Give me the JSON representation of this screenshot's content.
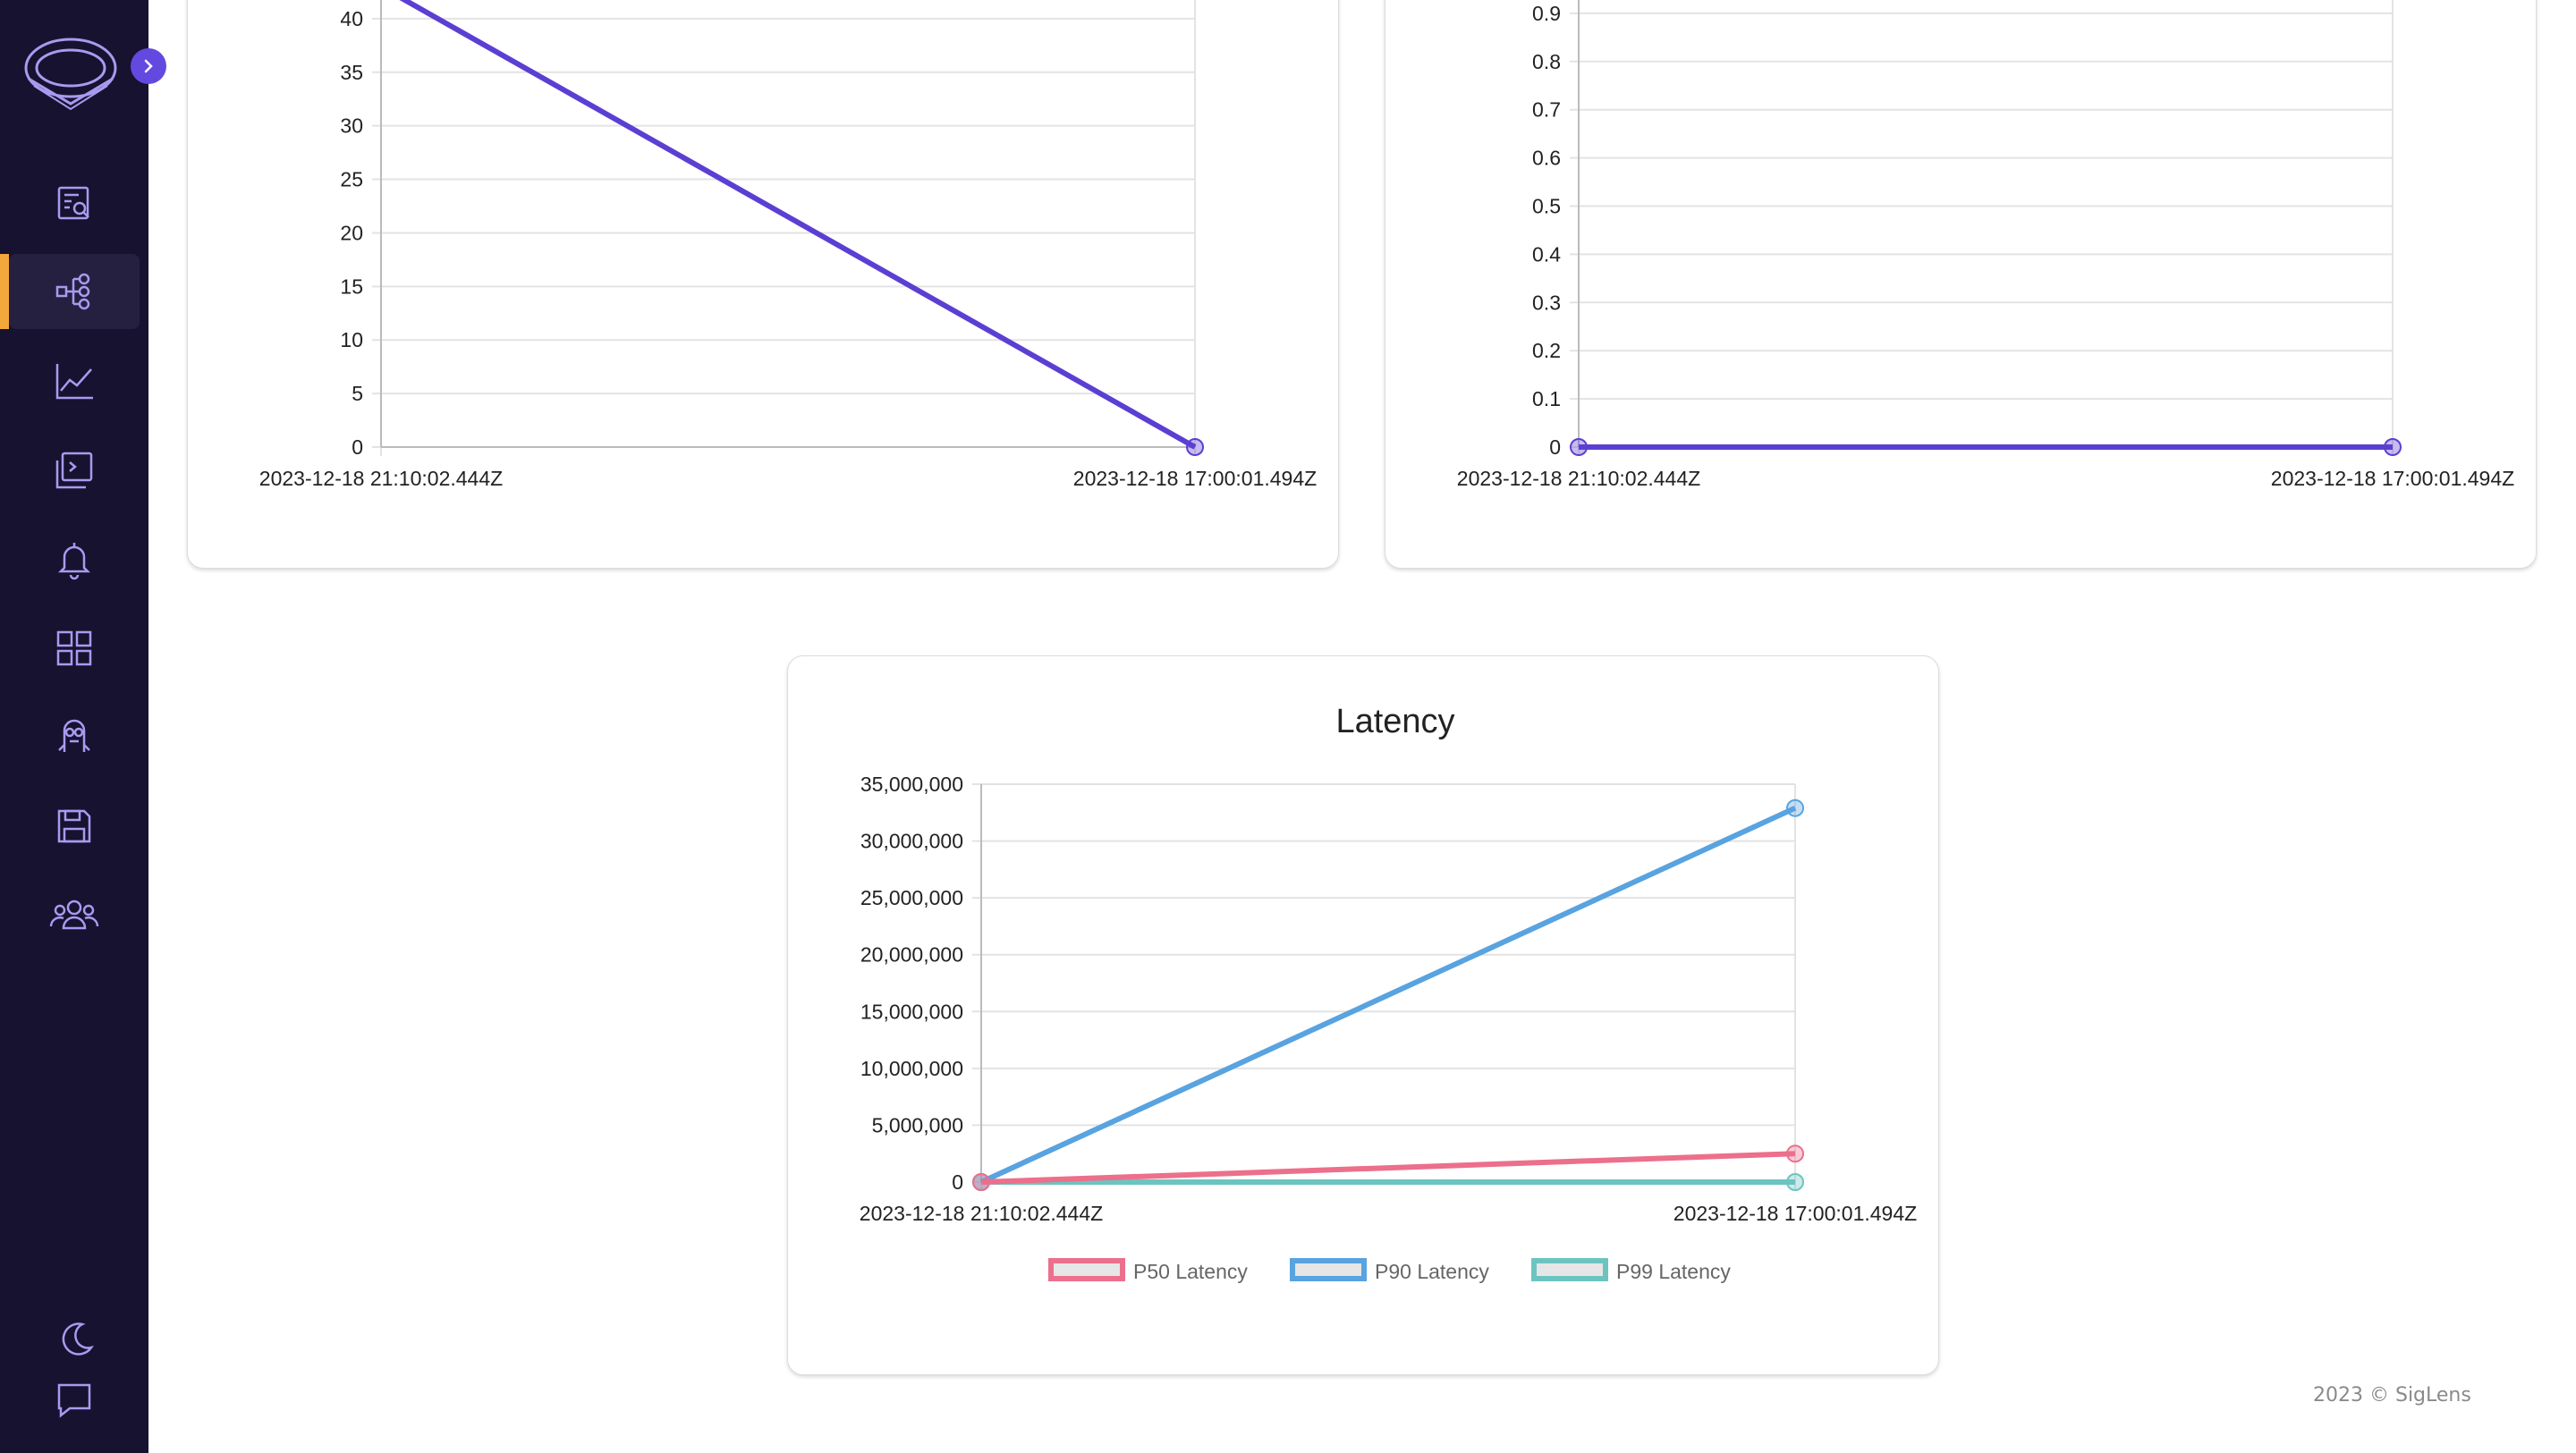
{
  "app": {
    "footer": "2023 © SigLens"
  },
  "sidebar": {
    "items": [
      {
        "icon": "search-logs-icon",
        "active": false
      },
      {
        "icon": "tracing-icon",
        "active": true
      },
      {
        "icon": "metrics-icon",
        "active": false
      },
      {
        "icon": "live-tail-icon",
        "active": false
      },
      {
        "icon": "alerts-icon",
        "active": false
      },
      {
        "icon": "dashboards-icon",
        "active": false
      },
      {
        "icon": "minions-icon",
        "active": false
      },
      {
        "icon": "saved-queries-icon",
        "active": false
      },
      {
        "icon": "users-icon",
        "active": false
      }
    ],
    "bottom": [
      {
        "icon": "dark-mode-icon"
      },
      {
        "icon": "feedback-icon"
      }
    ],
    "accent_color": "#6449e0",
    "active_marker_color": "#f3a83c"
  },
  "charts": [
    {
      "id": "top-left",
      "chart_data": {
        "type": "line",
        "x": [
          "2023-12-18 21:10:02.444Z",
          "2023-12-18 17:00:01.494Z"
        ],
        "y_ticks": [
          "0",
          "5",
          "10",
          "15",
          "20",
          "25",
          "30",
          "35",
          "40"
        ],
        "ylim": [
          0,
          45
        ],
        "series": [
          {
            "color": "#5b3fd3",
            "values": [
              43,
              0
            ]
          }
        ]
      }
    },
    {
      "id": "top-right",
      "chart_data": {
        "type": "line",
        "x": [
          "2023-12-18 21:10:02.444Z",
          "2023-12-18 17:00:01.494Z"
        ],
        "y_ticks": [
          "0",
          "0.1",
          "0.2",
          "0.3",
          "0.4",
          "0.5",
          "0.6",
          "0.7",
          "0.8",
          "0.9"
        ],
        "ylim": [
          0,
          1
        ],
        "series": [
          {
            "color": "#5b3fd3",
            "values": [
              0,
              0
            ]
          }
        ]
      }
    },
    {
      "id": "latency",
      "chart_data": {
        "type": "line",
        "title": "Latency",
        "x": [
          "2023-12-18 21:10:02.444Z",
          "2023-12-18 17:00:01.494Z"
        ],
        "y_ticks": [
          "0",
          "5,000,000",
          "10,000,000",
          "15,000,000",
          "20,000,000",
          "25,000,000",
          "30,000,000",
          "35,000,000"
        ],
        "ylim": [
          0,
          35000000
        ],
        "legend_position": "bottom",
        "series": [
          {
            "name": "P50 Latency",
            "color": "#ec6f8b",
            "values": [
              0,
              2500000
            ]
          },
          {
            "name": "P90 Latency",
            "color": "#58a3e0",
            "values": [
              0,
              32900000
            ]
          },
          {
            "name": "P99 Latency",
            "color": "#6cc4c0",
            "values": [
              0,
              0
            ]
          }
        ]
      }
    }
  ]
}
